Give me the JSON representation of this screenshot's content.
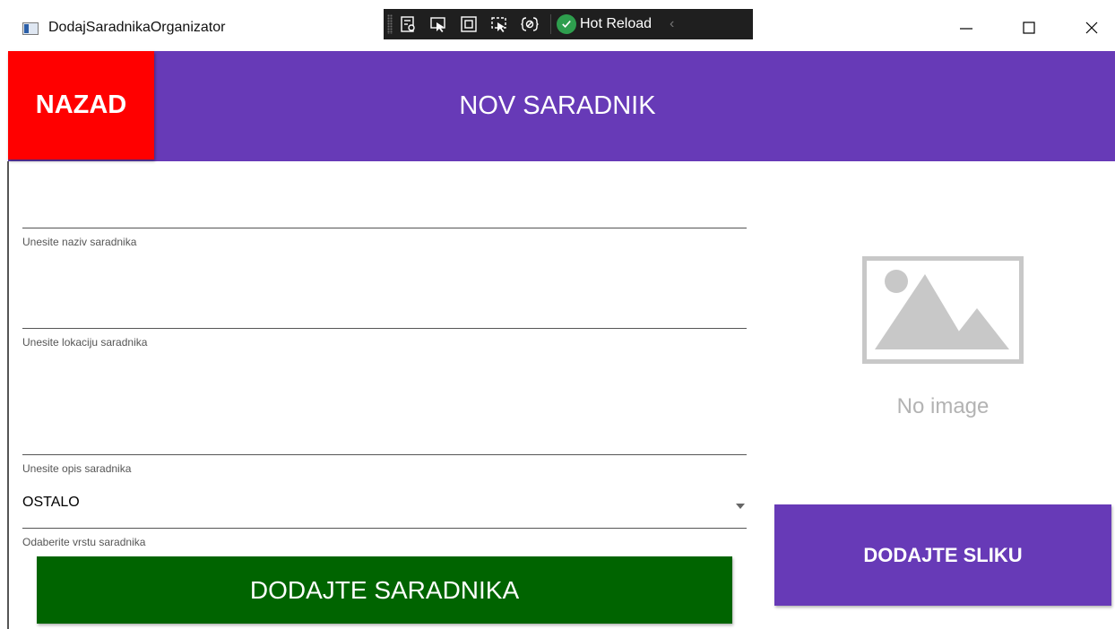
{
  "window": {
    "title": "DodajSaradnikaOrganizator",
    "hot_reload_label": "Hot Reload",
    "toolbar_icons": [
      "live-visual-tree-icon",
      "select-element-icon",
      "display-adorners-icon",
      "track-focus-icon",
      "binding-failures-icon"
    ],
    "controls": [
      "minimize-icon",
      "maximize-icon",
      "close-icon"
    ]
  },
  "header": {
    "back_label": "NAZAD",
    "title": "NOV SARADNIK",
    "background_color": "#673ab7",
    "back_color": "#ff0000"
  },
  "form": {
    "name_caption": "Unesite naziv saradnika",
    "name_value": "",
    "location_caption": "Unesite lokaciju saradnika",
    "location_value": "",
    "description_caption": "Unesite opis saradnika",
    "description_value": "",
    "type_value": "OSTALO",
    "type_caption": "Odaberite vrstu saradnika",
    "submit_label": "DODAJTE SARADNIKA",
    "submit_color": "#006400"
  },
  "image_panel": {
    "placeholder_icon": "image-placeholder-icon",
    "no_image_text": "No image",
    "add_image_label": "DODAJTE SLIKU"
  }
}
